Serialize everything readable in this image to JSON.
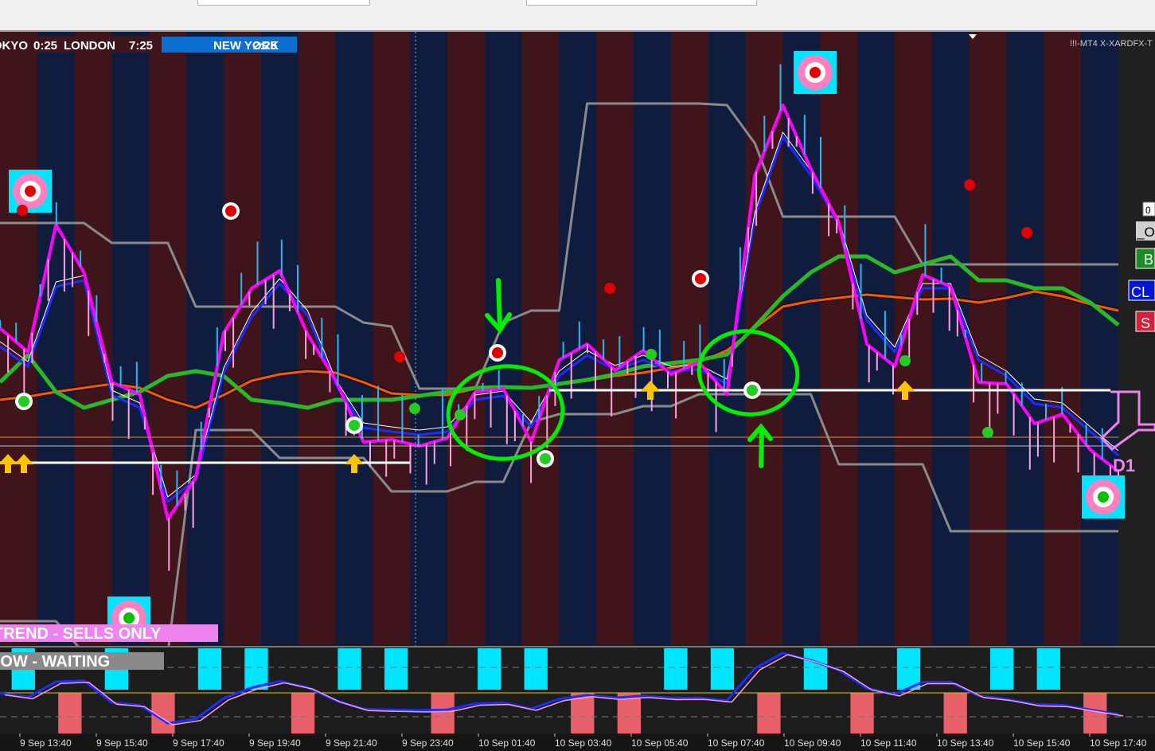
{
  "window": {
    "title": "!!!-MT4 X-XARDFX-T"
  },
  "sessions": {
    "tokyo_label": "TOKYO",
    "tokyo_time": "0:25",
    "london_label": "LONDON",
    "london_time": "7:25",
    "newyork_label": "NEW YORK",
    "newyork_time": "2:25"
  },
  "status": {
    "trend_text": "TREND - SELLS ONLY",
    "flow_text": "FLOW - WAITING"
  },
  "side_buttons": {
    "value_box": "0",
    "orders_label": "_O",
    "buy_label": "B",
    "close_label": "CL",
    "sell_label": "S"
  },
  "daily_marker": {
    "label": "D1"
  },
  "colors": {
    "bg_red": "#3f141b",
    "bg_blue": "#0f1c3e",
    "price_pink": "#ff00ff",
    "price_light_pink": "#ff9ee0",
    "fast_blue": "#1a2cff",
    "channel_grey": "#8a8a8a",
    "ma_green": "#28b828",
    "ma_orange": "#ff5500",
    "signal_cyan": "#00e5ff",
    "hist_red": "#e8606a",
    "arrow_yellow": "#ffc400",
    "annotation_green": "#00ee00"
  },
  "icons": {
    "sell_signal": "target-icon",
    "buy_signal": "target-icon",
    "buy_arrow": "up-arrow-icon",
    "annotation_down": "down-arrow-icon",
    "annotation_up": "up-arrow-icon"
  },
  "chart_data": {
    "type": "line",
    "title": "!!!-MT4 X-XARDFX-T",
    "x_tick_labels": [
      "9 Sep 13:40",
      "9 Sep 15:40",
      "9 Sep 17:40",
      "9 Sep 19:40",
      "9 Sep 21:40",
      "9 Sep 23:40",
      "10 Sep 01:40",
      "10 Sep 03:40",
      "10 Sep 05:40",
      "10 Sep 07:40",
      "10 Sep 09:40",
      "10 Sep 11:40",
      "10 Sep 13:40",
      "10 Sep 15:40",
      "10 Sep 17:40"
    ],
    "y_axis": "price (unlabeled)",
    "grid": false,
    "background_sessions": [
      "red",
      "blue",
      "red",
      "blue",
      "red",
      "blue",
      "red",
      "blue",
      "red",
      "blue",
      "red",
      "blue",
      "red",
      "blue",
      "red",
      "blue",
      "red",
      "blue",
      "red",
      "blue",
      "red",
      "blue",
      "red",
      "blue",
      "red",
      "blue",
      "red",
      "blue",
      "red",
      "blue"
    ],
    "series": [
      {
        "role": "price",
        "values": [
          372,
          402,
          242,
          302,
          440,
          455,
          612,
          560,
          378,
          322,
          300,
          380,
          437,
          515,
          512,
          520,
          510,
          452,
          448,
          515,
          412,
          392,
          425,
          400,
          430,
          415,
          455,
          180,
          92,
          172,
          240,
          392,
          420,
          305,
          320,
          440,
          442,
          492,
          480,
          525,
          552
        ]
      },
      {
        "role": "fast_ma",
        "values": [
          395,
          420,
          320,
          312,
          456,
          472,
          590,
          562,
          428,
          358,
          316,
          356,
          442,
          497,
          502,
          506,
          502,
          462,
          457,
          496,
          432,
          406,
          425,
          412,
          426,
          424,
          442,
          232,
          132,
          180,
          242,
          362,
          402,
          322,
          322,
          412,
          432,
          467,
          472,
          502,
          532
        ]
      },
      {
        "role": "slow_ma",
        "values": [
          440,
          406,
          452,
          472,
          462,
          452,
          432,
          426,
          432,
          462,
          466,
          472,
          462,
          462,
          462,
          457,
          452,
          447,
          446,
          447,
          442,
          437,
          430,
          420,
          416,
          412,
          405,
          370,
          332,
          302,
          282,
          282,
          302,
          292,
          282,
          312,
          312,
          322,
          322,
          340,
          368
        ]
      },
      {
        "role": "long_ma",
        "values": [
          462,
          458,
          452,
          447,
          442,
          447,
          462,
          472,
          456,
          438,
          430,
          426,
          428,
          440,
          454,
          456,
          456,
          448,
          446,
          447,
          442,
          438,
          432,
          428,
          422,
          415,
          400,
          372,
          345,
          338,
          334,
          330,
          333,
          336,
          335,
          340,
          334,
          326,
          332,
          342,
          350
        ]
      },
      {
        "role": "channel_upper",
        "values": [
          240,
          240,
          240,
          240,
          265,
          265,
          265,
          345,
          345,
          345,
          345,
          345,
          345,
          365,
          370,
          448,
          448,
          448,
          365,
          350,
          350,
          90,
          90,
          90,
          90,
          90,
          92,
          140,
          232,
          232,
          232,
          232,
          232,
          292,
          292,
          292,
          292,
          292,
          292,
          292,
          292
        ]
      },
      {
        "role": "channel_lower",
        "values": [
          740,
          740,
          740,
          780,
          780,
          780,
          780,
          500,
          500,
          500,
          535,
          535,
          535,
          535,
          577,
          577,
          577,
          565,
          565,
          490,
          480,
          480,
          480,
          470,
          470,
          455,
          455,
          455,
          455,
          455,
          543,
          543,
          543,
          543,
          627,
          627,
          627,
          627,
          627,
          627,
          627
        ]
      }
    ],
    "lower_panel": {
      "type": "histogram+line",
      "bars": [
        "up",
        "down",
        "up",
        "down",
        "up",
        "up",
        "down",
        "up",
        "up",
        "down",
        "up",
        "up",
        "down",
        "down",
        "up",
        "up",
        "down",
        "up",
        "down",
        "up",
        "down",
        "up",
        "up",
        "down"
      ]
    }
  }
}
